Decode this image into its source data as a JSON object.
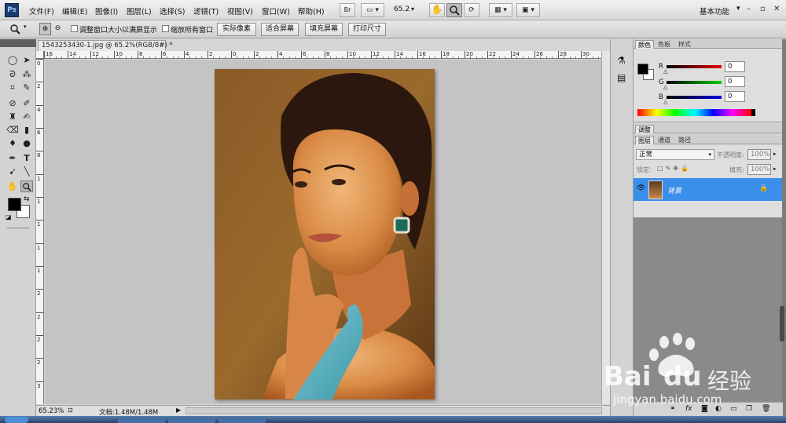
{
  "app": {
    "logo": "Ps"
  },
  "menu": [
    "文件(F)",
    "编辑(E)",
    "图像(I)",
    "图层(L)",
    "选择(S)",
    "滤镜(T)",
    "视图(V)",
    "窗口(W)",
    "帮助(H)"
  ],
  "appbar": {
    "br_label": "Br",
    "zoom": "65.2",
    "workspace": "基本功能"
  },
  "options": {
    "resize_windows": "调整窗口大小以满屏显示",
    "zoom_all": "缩放所有窗口",
    "actual_pixels": "实际像素",
    "fit_screen": "适合屏幕",
    "fill_screen": "填充屏幕",
    "print_size": "打印尺寸"
  },
  "document": {
    "tab_title": "1543253430-1.jpg @ 65.2%(RGB/8#) *",
    "zoom_status": "65.23%",
    "doc_info": "文档:1.48M/1.48M"
  },
  "ruler_h_labels": [
    "16",
    "14",
    "12",
    "10",
    "8",
    "6",
    "4",
    "2",
    "0",
    "2",
    "4",
    "6",
    "8",
    "10",
    "12",
    "14",
    "16",
    "18",
    "20",
    "22",
    "24",
    "26",
    "28",
    "30"
  ],
  "ruler_v_labels": [
    "0",
    "2",
    "4",
    "6",
    "8",
    "1",
    "1",
    "1",
    "1",
    "1",
    "2",
    "2",
    "2",
    "2",
    "3"
  ],
  "color_panel": {
    "tabs": [
      "颜色",
      "色板",
      "样式"
    ],
    "r_label": "R",
    "g_label": "G",
    "b_label": "B",
    "r": "0",
    "g": "0",
    "b": "0"
  },
  "adjust_panel": {
    "title": "调整"
  },
  "layers_panel": {
    "tabs": [
      "图层",
      "通道",
      "路径"
    ],
    "blend_mode": "正常",
    "opacity_label": "不透明度:",
    "opacity": "100%",
    "lock_label": "锁定:",
    "fill_label": "填充:",
    "fill": "100%",
    "layer_name": "背景"
  },
  "watermark": {
    "brand_a": "Bai",
    "brand_b": "du",
    "brand_cn": "经验",
    "url": "jingyan.baidu.com"
  },
  "colors": {
    "accent_layer": "#3b8eea",
    "ps_logo": "#1c3b6e"
  }
}
